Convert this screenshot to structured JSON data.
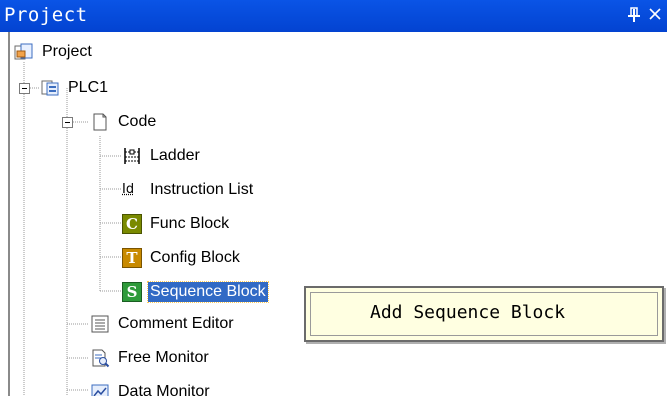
{
  "panel": {
    "title": "Project",
    "pin_icon": "pin-icon",
    "close_icon": "close-icon"
  },
  "tree": {
    "root": {
      "label": "Project",
      "icon": "project-icon"
    },
    "plc": {
      "label": "PLC1",
      "icon": "plc-icon"
    },
    "code": {
      "label": "Code",
      "icon": "document-icon"
    },
    "items": [
      {
        "label": "Ladder",
        "icon": "ladder-icon"
      },
      {
        "label": "Instruction List",
        "icon": "instruction-list-icon",
        "glyph": "Id"
      },
      {
        "label": "Func Block",
        "icon": "func-block-icon",
        "glyph": "C",
        "color": "#7a8a00"
      },
      {
        "label": "Config Block",
        "icon": "config-block-icon",
        "glyph": "T",
        "color": "#c88a00"
      },
      {
        "label": "Sequence Block",
        "icon": "sequence-block-icon",
        "glyph": "S",
        "color": "#2e9a3a",
        "selected": true
      }
    ],
    "tools": [
      {
        "label": "Comment Editor",
        "icon": "comment-editor-icon"
      },
      {
        "label": "Free Monitor",
        "icon": "free-monitor-icon"
      },
      {
        "label": "Data Monitor",
        "icon": "data-monitor-icon"
      }
    ]
  },
  "popup": {
    "label": "Add Sequence Block"
  }
}
